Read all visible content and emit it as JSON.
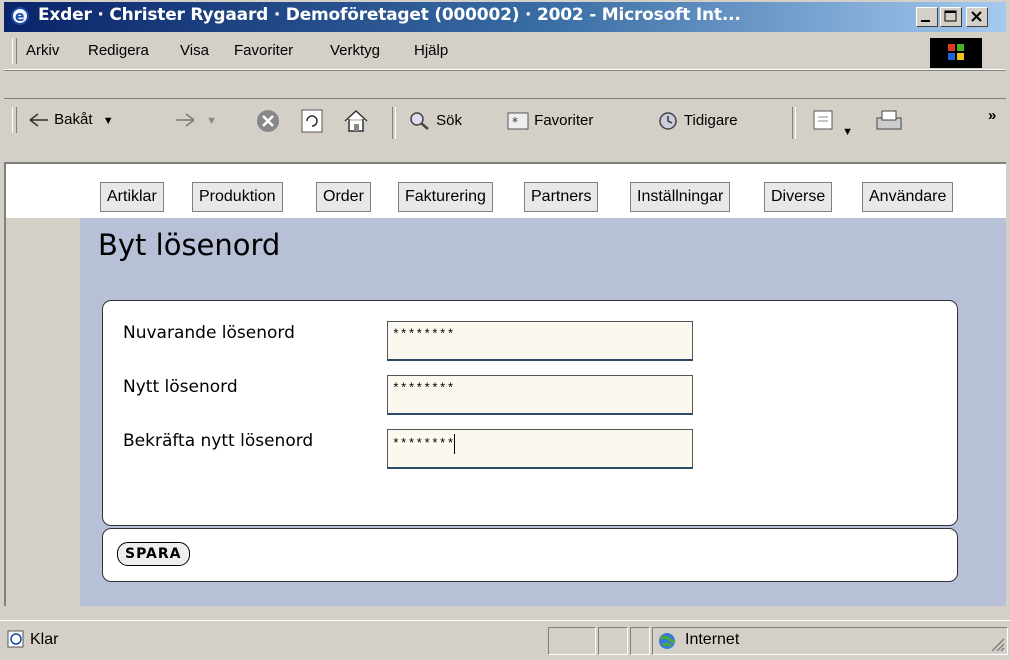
{
  "window": {
    "title": "Exder · Christer Rygaard · Demoföretaget (000002) · 2002 - Microsoft Int..."
  },
  "menu": [
    {
      "label": "Arkiv"
    },
    {
      "label": "Redigera"
    },
    {
      "label": "Visa"
    },
    {
      "label": "Favoriter"
    },
    {
      "label": "Verktyg"
    },
    {
      "label": "Hjälp"
    }
  ],
  "toolbar": {
    "back": "Bakåt",
    "search": "Sök",
    "favorites": "Favoriter",
    "history": "Tidigare",
    "more": "»"
  },
  "nav_tabs": [
    {
      "label": "Artiklar"
    },
    {
      "label": "Produktion"
    },
    {
      "label": "Order"
    },
    {
      "label": "Fakturering"
    },
    {
      "label": "Partners"
    },
    {
      "label": "Inställningar"
    },
    {
      "label": "Diverse"
    },
    {
      "label": "Användare"
    }
  ],
  "page": {
    "title": "Byt lösenord"
  },
  "form": {
    "current_label": "Nuvarande lösenord",
    "current_value": "********",
    "new_label": "Nytt lösenord",
    "new_value": "********",
    "confirm_label": "Bekräfta nytt lösenord",
    "confirm_value": "********",
    "save_label": "SPARA"
  },
  "status": {
    "text": "Klar",
    "zone": "Internet"
  },
  "colors": {
    "titlebar_start": "#0a246a",
    "titlebar_end": "#a6caf0",
    "content_bg": "#b8c0d8",
    "input_bg": "#fbf8ef"
  }
}
